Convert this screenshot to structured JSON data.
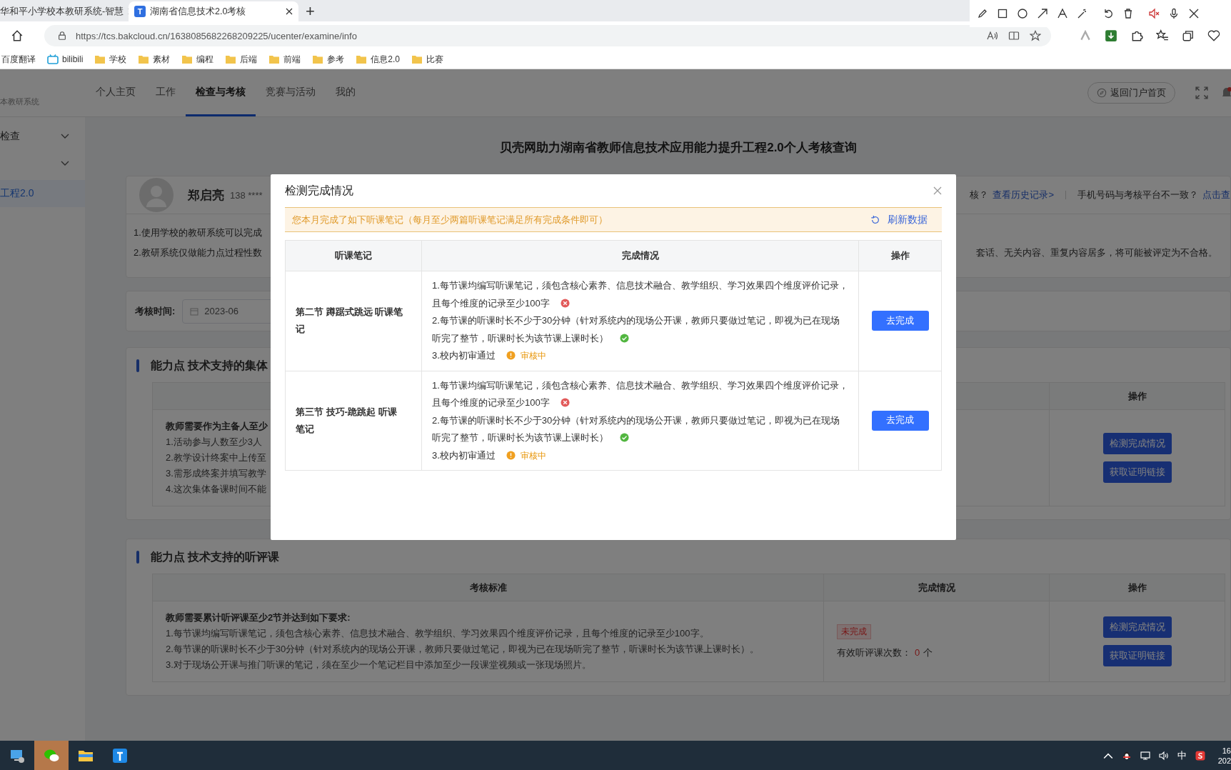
{
  "browser": {
    "tabs": [
      {
        "title": "华和平小学校本教研系统-智慧",
        "selected": false
      },
      {
        "title": "湖南省信息技术2.0考核",
        "icon_letter": "T",
        "selected": true
      }
    ],
    "new_tab": "+",
    "url": "https://tcs.bakcloud.cn/1638085682268209225/ucenter/examine/info",
    "bookmarks": [
      {
        "label": "百度翻译",
        "kind": "plain"
      },
      {
        "label": "bilibili",
        "kind": "tv"
      },
      {
        "label": "学校",
        "kind": "folder"
      },
      {
        "label": "素材",
        "kind": "folder"
      },
      {
        "label": "编程",
        "kind": "folder"
      },
      {
        "label": "后端",
        "kind": "folder"
      },
      {
        "label": "前端",
        "kind": "folder"
      },
      {
        "label": "参考",
        "kind": "folder"
      },
      {
        "label": "信息2.0",
        "kind": "folder"
      },
      {
        "label": "比赛",
        "kind": "folder"
      }
    ]
  },
  "header": {
    "system_name": "本教研系统",
    "nav": [
      {
        "label": "个人主页",
        "selected": false
      },
      {
        "label": "工作",
        "selected": false
      },
      {
        "label": "检查与考核",
        "selected": true
      },
      {
        "label": "竞赛与活动",
        "selected": false
      },
      {
        "label": "我的",
        "selected": false
      }
    ],
    "portal_button": "返回门户首页"
  },
  "sidebar": {
    "items": [
      {
        "kind": "group",
        "label": "检查"
      },
      {
        "kind": "chevron"
      },
      {
        "kind": "link",
        "label": "工程2.0"
      }
    ]
  },
  "page_title": "贝壳网助力湖南省教师信息技术应用能力提升工程2.0个人考核查询",
  "user": {
    "name": "郑启亮",
    "phone": "138 ****",
    "history_prompt": "核？",
    "history_link": "查看历史记录>",
    "phone_prompt": "手机号码与考核平台不一致？",
    "phone_link": "点击查",
    "notes": [
      "1.使用学校的教研系统可以完成",
      "2.教研系统仅做能力点过程性数"
    ],
    "note_tail": "套话、无关内容、重复内容居多，将可能被评定为不合格。"
  },
  "filter": {
    "label": "考核时间:",
    "value": "2023-06"
  },
  "sections": [
    {
      "heading": "能力点 技术支持的集体",
      "columns": [
        {
          "label": "操作"
        }
      ],
      "intro": "教师需要作为主备人至少",
      "items": [
        "1.活动参与人数至少3人",
        "2.教学设计终案中上传至",
        "3.需形成终案并填写教学",
        "4.这次集体备课时间不能"
      ],
      "buttons": [
        "检测完成情况",
        "获取证明链接"
      ]
    },
    {
      "heading": "能力点 技术支持的听评课",
      "columns": [
        {
          "label": "考核标准"
        },
        {
          "label": "完成情况"
        },
        {
          "label": "操作"
        }
      ],
      "intro": "教师需要累计听评课至少2节并达到如下要求:",
      "items": [
        "1.每节课均编写听课笔记，须包含核心素养、信息技术融合、教学组织、学习效果四个维度评价记录，且每个维度的记录至少100字。",
        "2.每节课的听课时长不少于30分钟（针对系统内的现场公开课，教师只要做过笔记，即视为已在现场听完了整节，听课时长为该节课上课时长）。",
        "3.对于现场公开课与推门听课的笔记，须在至少一个笔记栏目中添加至少一段课堂视频或一张现场照片。"
      ],
      "status": "未完成",
      "count_label": "有效听评课次数：",
      "count": "0",
      "count_unit": "个",
      "buttons": [
        "检测完成情况",
        "获取证明链接"
      ]
    }
  ],
  "modal": {
    "title": "检测完成情况",
    "notice": "您本月完成了如下听课笔记（每月至少两篇听课笔记满足所有完成条件即可）",
    "refresh": "刷新数据",
    "columns": [
      "听课笔记",
      "完成情况",
      "操作"
    ],
    "rows": [
      {
        "note": "第二节 蹲踞式跳远 听课笔记",
        "action": "去完成",
        "checks": [
          {
            "kind": "fail",
            "text": "1.每节课均编写听课笔记，须包含核心素养、信息技术融合、教学组织、学习效果四个维度评价记录，且每个维度的记录至少100字"
          },
          {
            "kind": "pass",
            "text": "2.每节课的听课时长不少于30分钟（针对系统内的现场公开课，教师只要做过笔记，即视为已在现场听完了整节，听课时长为该节课上课时长）"
          },
          {
            "kind": "pending",
            "text": "3.校内初审通过",
            "status": "审核中"
          }
        ]
      },
      {
        "note": "第三节 技巧-跪跳起 听课笔记",
        "action": "去完成",
        "checks": [
          {
            "kind": "fail",
            "text": "1.每节课均编写听课笔记，须包含核心素养、信息技术融合、教学组织、学习效果四个维度评价记录，且每个维度的记录至少100字"
          },
          {
            "kind": "pass",
            "text": "2.每节课的听课时长不少于30分钟（针对系统内的现场公开课，教师只要做过笔记，即视为已在现场听完了整节，听课时长为该节课上课时长）"
          },
          {
            "kind": "pending",
            "text": "3.校内初审通过",
            "status": "审核中"
          }
        ]
      }
    ]
  },
  "taskbar": {
    "ime": "中",
    "clock": [
      "16",
      "202"
    ]
  }
}
